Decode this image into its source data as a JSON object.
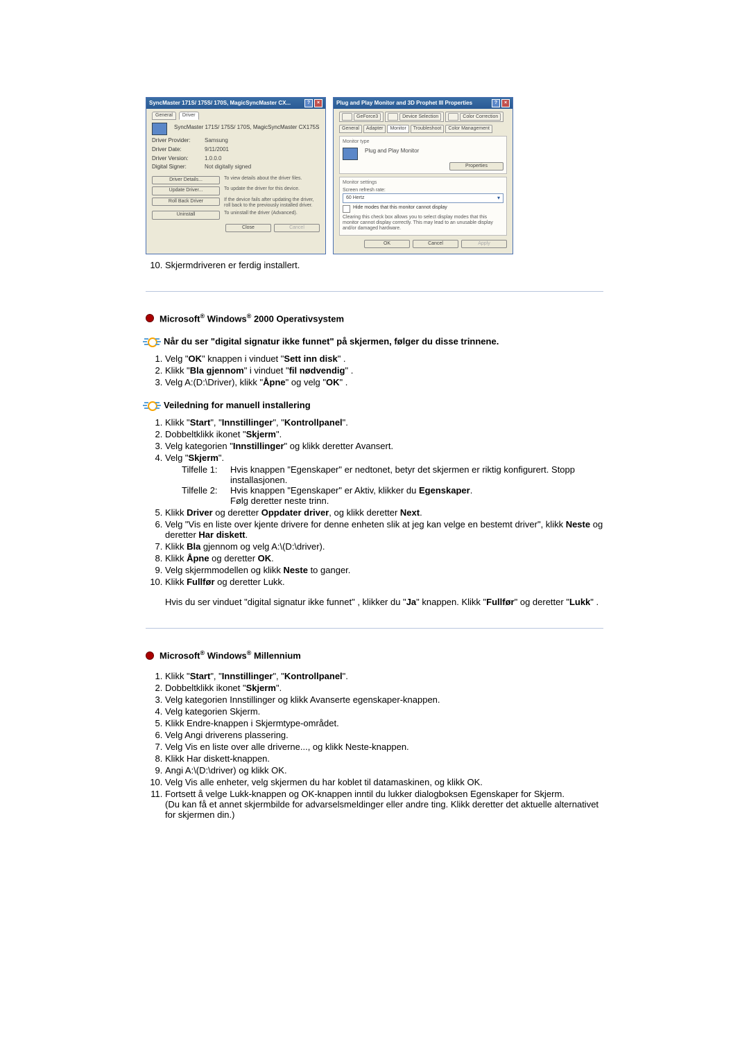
{
  "dlg1": {
    "title": "SyncMaster 171S/ 175S/ 170S, MagicSyncMaster CX...",
    "tab_general": "General",
    "tab_driver": "Driver",
    "device_name": "SyncMaster 171S/ 175S/ 170S, MagicSyncMaster CX175S",
    "rows": {
      "provider_lbl": "Driver Provider:",
      "provider_val": "Samsung",
      "date_lbl": "Driver Date:",
      "date_val": "9/11/2001",
      "version_lbl": "Driver Version:",
      "version_val": "1.0.0.0",
      "signer_lbl": "Digital Signer:",
      "signer_val": "Not digitally signed"
    },
    "btns": {
      "details": "Driver Details...",
      "details_desc": "To view details about the driver files.",
      "update": "Update Driver...",
      "update_desc": "To update the driver for this device.",
      "rollback": "Roll Back Driver",
      "rollback_desc": "If the device fails after updating the driver, roll back to the previously installed driver.",
      "uninstall": "Uninstall",
      "uninstall_desc": "To uninstall the driver (Advanced).",
      "close": "Close",
      "cancel": "Cancel"
    }
  },
  "dlg2": {
    "title": "Plug and Play Monitor and 3D Prophet III Properties",
    "tabs": {
      "geforce": "GeForce3",
      "devsel": "Device Selection",
      "colorcorr": "Color Correction",
      "general": "General",
      "adapter": "Adapter",
      "monitor": "Monitor",
      "troubleshoot": "Troubleshoot",
      "colormgmt": "Color Management"
    },
    "montype_lbl": "Monitor type",
    "montype_val": "Plug and Play Monitor",
    "properties_btn": "Properties",
    "settings_lbl": "Monitor settings",
    "refresh_lbl": "Screen refresh rate:",
    "refresh_val": "60 Hertz",
    "chk_hide": "Hide modes that this monitor cannot display",
    "chk_note": "Clearing this check box allows you to select display modes that this monitor cannot display correctly. This may lead to an unusable display and/or damaged hardware.",
    "ok": "OK",
    "cancel": "Cancel",
    "apply": "Apply"
  },
  "step10": "Skjermdriveren er ferdig installert.",
  "sec2000": {
    "title_pre": "Microsoft",
    "title_mid": " Windows",
    "title_post": " 2000 Operativsystem",
    "sub1": "Når du ser \"digital signatur ikke funnet\" på skjermen, følger du disse trinnene.",
    "s1": {
      "a1": "Velg \"",
      "a2": "OK",
      "a3": "\" knappen i vinduet \"",
      "a4": "Sett inn disk",
      "a5": "\" ."
    },
    "s2": {
      "a1": "Klikk \"",
      "a2": "Bla gjennom",
      "a3": "\" i vinduet \"",
      "a4": "fil nødvendig",
      "a5": "\" ."
    },
    "s3": {
      "a1": "Velg A:(D:\\Driver), klikk \"",
      "a2": "Åpne",
      "a3": "\" og velg \"",
      "a4": "OK",
      "a5": "\" ."
    },
    "sub2": "Veiledning for manuell installering",
    "m1": {
      "a1": "Klikk \"",
      "a2": "Start",
      "a3": "\", \"",
      "a4": "Innstillinger",
      "a5": "\", \"",
      "a6": "Kontrollpanel",
      "a7": "\"."
    },
    "m2": {
      "a1": "Dobbeltklikk ikonet \"",
      "a2": "Skjerm",
      "a3": "\"."
    },
    "m3": {
      "a1": "Velg kategorien \"",
      "a2": "Innstillinger",
      "a3": "\" og klikk deretter Avansert."
    },
    "m4": {
      "a1": "Velg \"",
      "a2": "Skjerm",
      "a3": "\"."
    },
    "t1_lbl": "Tilfelle 1:",
    "t1_txt": "Hvis knappen \"Egenskaper\" er nedtonet, betyr det skjermen er riktig konfigurert. Stopp installasjonen.",
    "t1_cont": "Stopp installasjonen.",
    "t2_lbl": "Tilfelle 2:",
    "t2_a1": "Hvis knappen \"Egenskaper\" er Aktiv, klikker du ",
    "t2_a2": "Egenskaper",
    "t2_a3": ".",
    "t2_cont": "Følg deretter neste trinn.",
    "m5": {
      "a1": "Klikk ",
      "a2": "Driver",
      "a3": " og deretter ",
      "a4": "Oppdater driver",
      "a5": ", og klikk deretter ",
      "a6": "Next",
      "a7": "."
    },
    "m6": {
      "a1": "Velg \"Vis en liste over kjente drivere for denne enheten slik at jeg kan velge en bestemt driver\", klikk ",
      "a2": "Neste",
      "a3": " og deretter ",
      "a4": "Har diskett",
      "a5": "."
    },
    "m7": {
      "a1": "Klikk ",
      "a2": "Bla",
      "a3": " gjennom og velg A:\\(D:\\driver)."
    },
    "m8": {
      "a1": "Klikk ",
      "a2": "Åpne",
      "a3": " og deretter ",
      "a4": "OK",
      "a5": "."
    },
    "m9": {
      "a1": "Velg skjermmodellen og klikk ",
      "a2": "Neste",
      "a3": " to ganger."
    },
    "m10": {
      "a1": "Klikk ",
      "a2": "Fullfør",
      "a3": " og deretter Lukk."
    },
    "post": {
      "a1": "Hvis du ser vinduet \"digital signatur ikke funnet\" , klikker du \"",
      "a2": "Ja",
      "a3": "\" knappen. Klikk \"",
      "a4": "Fullfør",
      "a5": "\" og deretter \"",
      "a6": "Lukk",
      "a7": "\" ."
    }
  },
  "secME": {
    "title_pre": "Microsoft",
    "title_mid": " Windows",
    "title_post": " Millennium",
    "m1": {
      "a1": "Klikk \"",
      "a2": "Start",
      "a3": "\", \"",
      "a4": "Innstillinger",
      "a5": "\", \"",
      "a6": "Kontrollpanel",
      "a7": "\"."
    },
    "m2": {
      "a1": "Dobbeltklikk ikonet \"",
      "a2": "Skjerm",
      "a3": "\"."
    },
    "m3": "Velg kategorien Innstillinger og klikk Avanserte egenskaper-knappen.",
    "m4": "Velg kategorien Skjerm.",
    "m5": "Klikk Endre-knappen i Skjermtype-området.",
    "m6": "Velg Angi driverens plassering.",
    "m7": "Velg Vis en liste over alle driverne..., og klikk Neste-knappen.",
    "m8": "Klikk Har diskett-knappen.",
    "m9": "Angi A:\\(D:\\driver) og klikk OK.",
    "m10": "Velg Vis alle enheter, velg skjermen du har koblet til datamaskinen, og klikk OK.",
    "m11a": "Fortsett å velge Lukk-knappen og OK-knappen inntil du lukker dialogboksen Egenskaper for Skjerm.",
    "m11b": "(Du kan få et annet skjermbilde for advarselsmeldinger eller andre ting. Klikk deretter det aktuelle alternativet for skjermen din.)"
  }
}
